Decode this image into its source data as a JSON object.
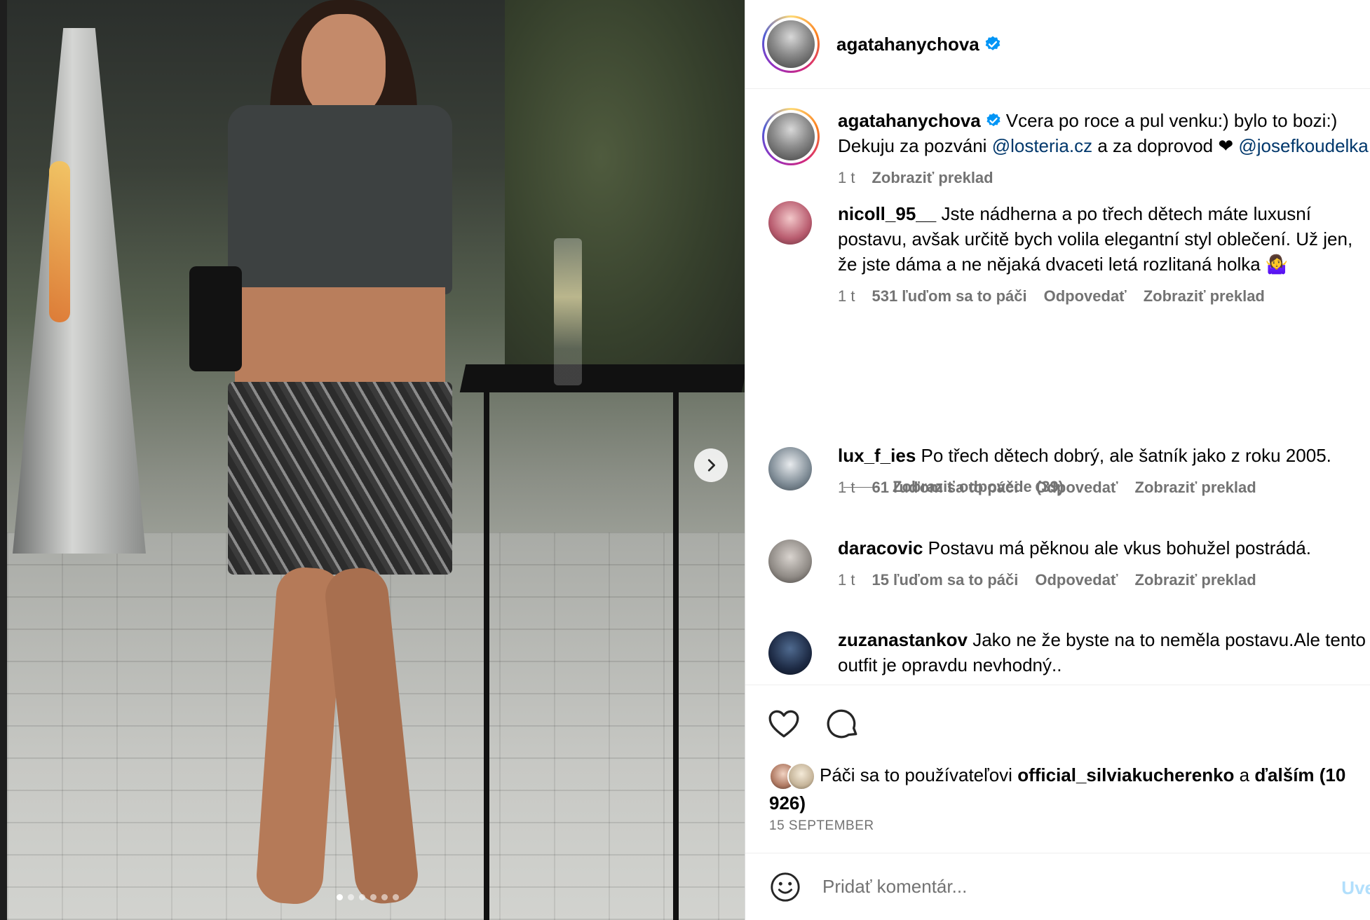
{
  "post": {
    "author": "agatahanychova",
    "caption_before": "Vcera po roce a pul venku:) bylo to bozi:) Dekuju za pozváni ",
    "caption_mention1": "@losteria.cz",
    "caption_mid": " a za doprovod ❤ ",
    "caption_mention2": "@josefkoudelka",
    "time": "1 t",
    "translate": "Zobraziť preklad"
  },
  "comments": [
    {
      "user": "nicoll_95__",
      "text": "Jste nádherna a po třech dětech máte luxusní postavu, avšak určitě bych volila elegantní styl oblečení. Už jen, že jste dáma a ne nějaká dvaceti letá rozlitaná holka 🤷‍♀️",
      "time": "1 t",
      "likes": "531 ľuďom sa to páči",
      "reply": "Odpovedať",
      "translate": "Zobraziť preklad",
      "avatar_color": "#b85b6e"
    },
    {
      "user": "lux_f_ies",
      "text": "Po třech dětech dobrý, ale šatník jako z roku 2005.",
      "time": "1 t",
      "likes": "61 ľuďom sa to páči",
      "reply": "Odpovedať",
      "translate": "Zobraziť preklad",
      "avatar_color": "#7d8a94"
    },
    {
      "user": "daracovic",
      "text": "Postavu má pěknou ale vkus bohužel postrádá.",
      "time": "1 t",
      "likes": "15 ľuďom sa to páči",
      "reply": "Odpovedať",
      "translate": "Zobraziť preklad",
      "avatar_color": "#8f8a85"
    },
    {
      "user": "zuzanastankov",
      "text": "Jako ne že byste na to neměla postavu.Ale tento outfit je opravdu nevhodný..",
      "avatar_color": "#1d2a44"
    }
  ],
  "view_replies": "Zobraziť odpovede (39)",
  "likes_line": {
    "prefix": "Páči sa to používateľovi ",
    "user": "official_silviakucherenko",
    "mid": " a ",
    "others": "ďalším (10 926)"
  },
  "date": "15 SEPTEMBER",
  "comment_placeholder": "Pridať komentár...",
  "post_button": "Uve",
  "icons": {
    "verified": "verified-badge-icon",
    "like": "heart-icon",
    "comment": "comment-icon",
    "emoji": "emoji-icon",
    "next": "chevron-right-icon"
  },
  "colors": {
    "link": "#00376b",
    "verified": "#0095f6",
    "muted": "#737373",
    "post_button": "#b2dffc"
  }
}
